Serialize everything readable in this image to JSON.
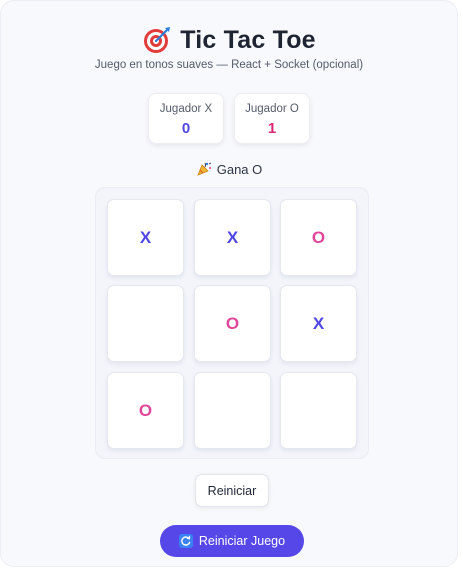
{
  "header": {
    "icon": "dart-target-icon",
    "title": "Tic Tac Toe",
    "subtitle": "Juego en tonos suaves — React + Socket (opcional)"
  },
  "scores": [
    {
      "label": "Jugador X",
      "value": "0",
      "color": "#4f46e5"
    },
    {
      "label": "Jugador O",
      "value": "1",
      "color": "#db2777"
    }
  ],
  "status": {
    "icon": "party-popper-icon",
    "text": "Gana O"
  },
  "board": {
    "colors": {
      "X": "#4f46e5",
      "O": "#e0479a"
    },
    "cells": [
      "X",
      "X",
      "O",
      "",
      "O",
      "X",
      "O",
      "",
      ""
    ]
  },
  "buttons": {
    "reset_label": "Reiniciar",
    "reset_game_label": "Reiniciar Juego",
    "reset_game_icon": "refresh-icon",
    "accent": "#5547e8"
  }
}
